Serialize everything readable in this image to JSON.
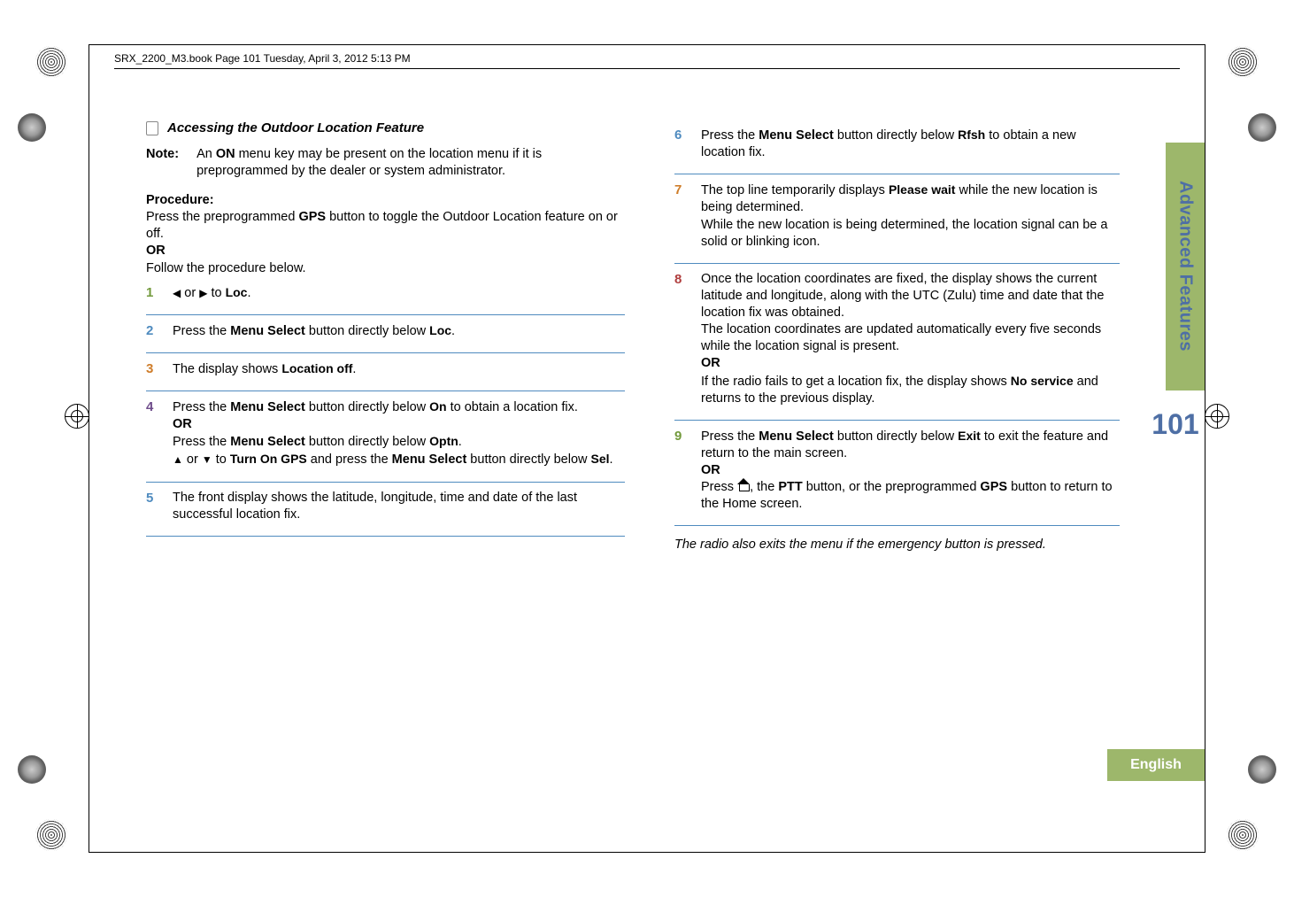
{
  "header": "SRX_2200_M3.book  Page 101  Tuesday, April 3, 2012  5:13 PM",
  "section": {
    "title": "Accessing the Outdoor Location Feature"
  },
  "note": {
    "label": "Note:",
    "text_a": "An ",
    "on": "ON",
    "text_b": " menu key may be present on the location menu if it is preprogrammed by the dealer or system administrator."
  },
  "procedure_label": "Procedure:",
  "intro": {
    "line1_a": "Press the preprogrammed ",
    "gps": "GPS",
    "line1_b": " button to toggle the Outdoor Location feature on or off.",
    "or": "OR",
    "line2": "Follow the procedure below."
  },
  "steps_left": {
    "s1": {
      "num": "1",
      "a": " or ",
      "b": " to ",
      "loc": "Loc",
      "end": "."
    },
    "s2": {
      "num": "2",
      "a": "Press the ",
      "ms": "Menu Select",
      "b": " button directly below ",
      "loc": "Loc",
      "end": "."
    },
    "s3": {
      "num": "3",
      "a": "The display shows ",
      "txt": "Location off",
      "end": "."
    },
    "s4": {
      "num": "4",
      "a": "Press the ",
      "ms": "Menu Select",
      "b": " button directly below ",
      "on": "On",
      "c": " to obtain a location fix.",
      "or": "OR",
      "d": "Press the ",
      "ms2": "Menu Select",
      "e": " button directly below ",
      "optn": "Optn",
      "f": ".",
      "g": " or ",
      "h": " to ",
      "turn": "Turn On GPS",
      "i": " and press the ",
      "ms3": "Menu Select",
      "j": " button directly below ",
      "sel": "Sel",
      "k": "."
    },
    "s5": {
      "num": "5",
      "a": "The front display shows the latitude, longitude, time and date of the last successful location fix."
    }
  },
  "steps_right": {
    "s6": {
      "num": "6",
      "a": "Press the ",
      "ms": "Menu Select",
      "b": " button directly below ",
      "rfsh": "Rfsh",
      "c": " to obtain a new location fix."
    },
    "s7": {
      "num": "7",
      "a": "The top line temporarily displays ",
      "pw": "Please wait",
      "b": " while the new location is being determined.",
      "c": "While the new location is being determined, the location signal can be a solid or blinking icon."
    },
    "s8": {
      "num": "8",
      "a": "Once the location coordinates are fixed, the display shows the current latitude and longitude, along with the UTC (Zulu) time and date that the location fix was obtained.",
      "b": "The location coordinates are updated automatically every five seconds while the location signal is present.",
      "or": "OR",
      "c": "If the radio fails to get a location fix, the display shows ",
      "ns": "No service",
      "d": " and returns to the previous display."
    },
    "s9": {
      "num": "9",
      "a": "Press the ",
      "ms": "Menu Select",
      "b": " button directly below ",
      "exit": "Exit",
      "c": " to exit the feature and return to the main screen.",
      "or": "OR",
      "d": "Press ",
      "e": ", the ",
      "ptt": "PTT",
      "f": " button, or the preprogrammed ",
      "gps": "GPS",
      "g": " button to return to the Home screen."
    }
  },
  "footnote": "The radio also exits the menu if the emergency button is pressed.",
  "tab": "Advanced Features",
  "pagenum": "101",
  "lang": "English"
}
